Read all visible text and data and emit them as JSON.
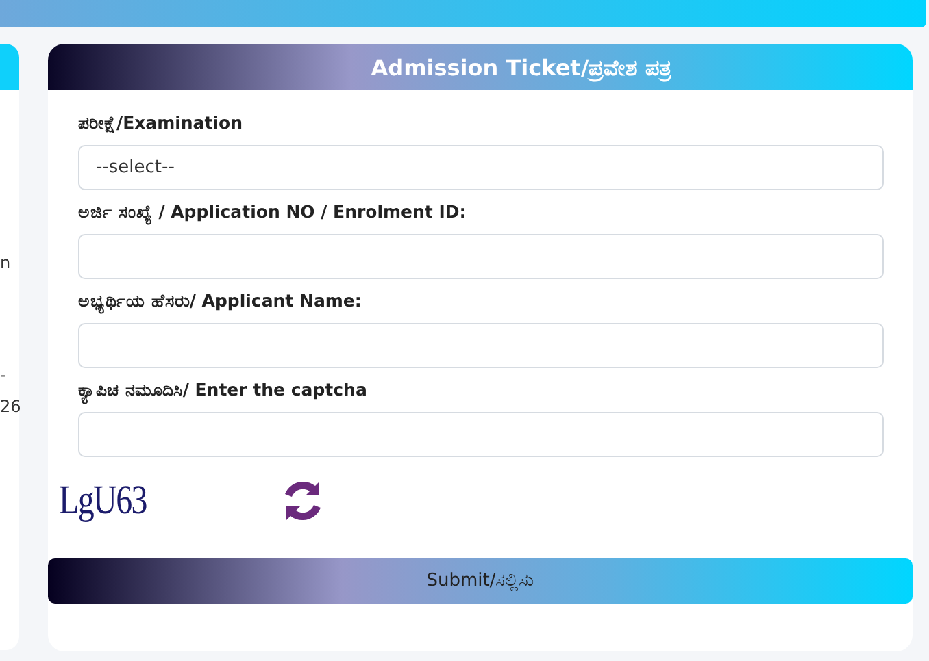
{
  "side_panel": {
    "fragments": [
      "n",
      "-",
      "26"
    ]
  },
  "card": {
    "title": "Admission Ticket/ಪ್ರವೇಶ ಪತ್ರ"
  },
  "fields": [
    {
      "kind": "select",
      "label": "ಪರೀಕ್ಷೆ/Examination",
      "value": "--select--"
    },
    {
      "kind": "text",
      "label": "ಅರ್ಜಿ ಸಂಖ್ಯೆ / Application NO / Enrolment ID:"
    },
    {
      "kind": "text",
      "label": "ಅಭ್ಯರ್ಥಿಯ ಹೆಸರು/ Applicant Name:"
    },
    {
      "kind": "text",
      "label": "ಕ್ಯಾಪಿಚ ನಮೂದಿಸಿ/ Enter the captcha"
    }
  ],
  "captcha": {
    "text": "LgU63"
  },
  "submit": {
    "label": "Submit/ಸಲ್ಲಿಸು"
  }
}
